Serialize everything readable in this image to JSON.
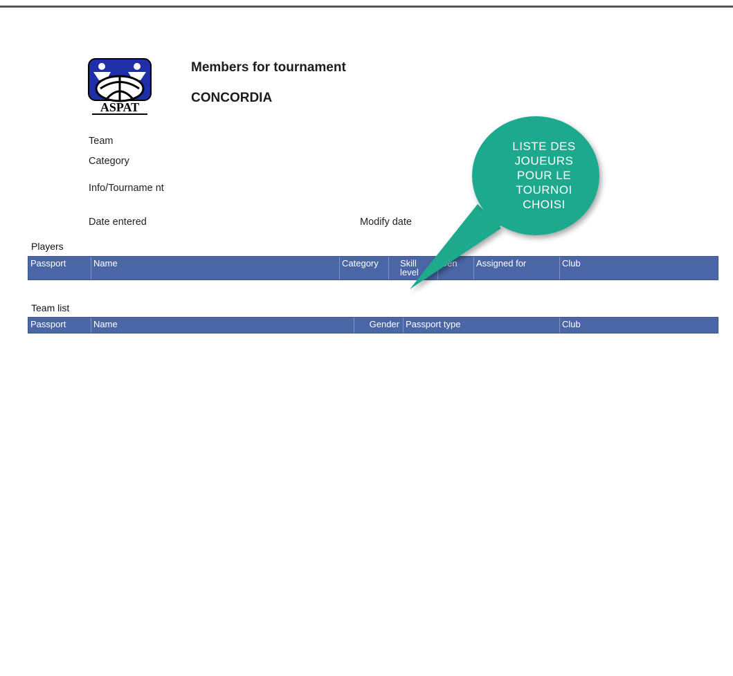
{
  "report": {
    "logo_text": "ASPAT",
    "title": "Members for tournament",
    "tournament_name": "CONCORDIA"
  },
  "fields": {
    "team": "Team",
    "category": "Category",
    "info": "Info/Tourname nt",
    "date_entered": "Date entered",
    "modify_date": "Modify date"
  },
  "players": {
    "heading": "Players",
    "columns": [
      "Passport",
      "Name",
      "Category",
      "Skill level",
      "Gen",
      "Assigned for",
      "Club"
    ]
  },
  "team_list": {
    "heading": "Team list",
    "columns": [
      "Passport",
      "Name",
      "Gender",
      "Passport type",
      "Club"
    ]
  },
  "callout": {
    "lines": [
      "LISTE DES",
      "JOUEURS",
      "POUR LE",
      "TOURNOI",
      "CHOISI"
    ],
    "color": "#1fa98d"
  },
  "colors": {
    "table_header": "#4a66a6",
    "logo_blue": "#1f2fa8"
  }
}
